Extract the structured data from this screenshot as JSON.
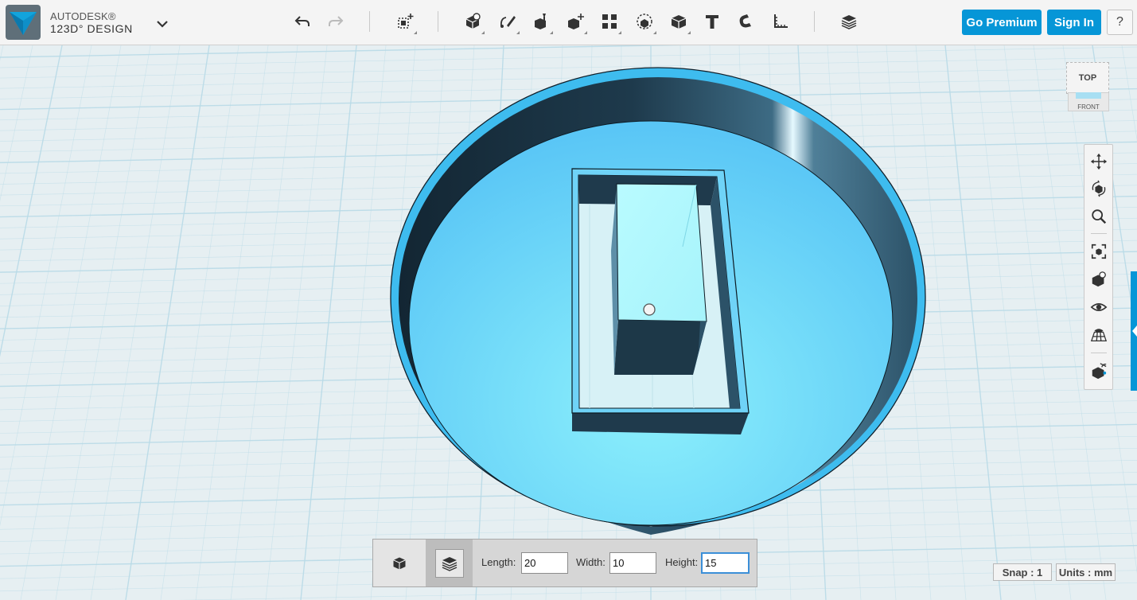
{
  "app": {
    "brand_line1": "AUTODESK®",
    "brand_line2": "123D° DESIGN"
  },
  "header": {
    "premium_label": "Go Premium",
    "signin_label": "Sign In",
    "help_label": "?"
  },
  "viewcube": {
    "top_label": "TOP",
    "front_label": "FRONT"
  },
  "dimensions": {
    "length_label": "Length:",
    "length_value": "20",
    "width_label": "Width:",
    "width_value": "10",
    "height_label": "Height:",
    "height_value": "15"
  },
  "status": {
    "snap_label": "Snap : 1",
    "units_label": "Units : mm"
  },
  "colors": {
    "accent": "#0696d7",
    "part_blue": "#6fd3f7",
    "part_dark": "#1f3a4c",
    "grid": "#b9dbe7"
  },
  "icons": {
    "toolbar": [
      "undo-icon",
      "redo-icon",
      "transform-icon",
      "primitives-icon",
      "sketch-icon",
      "construct-icon",
      "modify-icon",
      "pattern-icon",
      "grouping-icon",
      "combine-icon",
      "text-icon",
      "snap-icon",
      "measure-icon",
      "material-icon"
    ],
    "navbar": [
      "pan-icon",
      "orbit-icon",
      "zoom-icon",
      "fit-icon",
      "view-icon",
      "visibility-icon",
      "grid-icon",
      "material-view-icon"
    ]
  }
}
